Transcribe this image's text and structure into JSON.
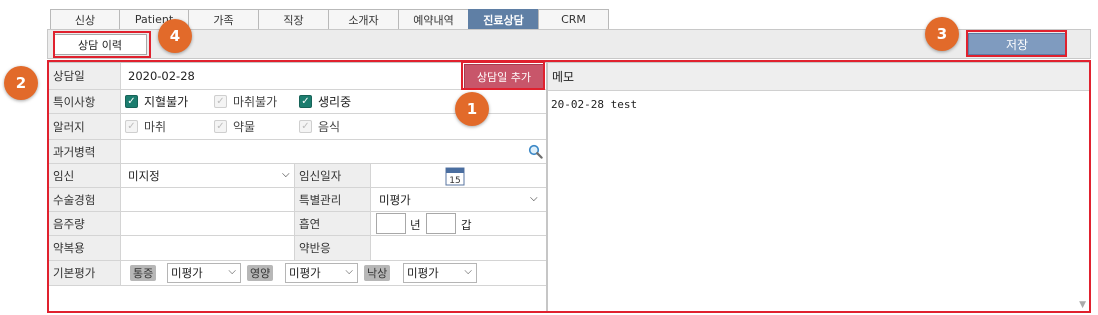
{
  "tabs": [
    "신상",
    "Patient",
    "가족",
    "직장",
    "소개자",
    "예약내역",
    "진료상담",
    "CRM"
  ],
  "active_tab": "진료상담",
  "toolbar": {
    "history_label": "상담 이력",
    "save_label": "저장"
  },
  "badges": [
    "1",
    "2",
    "3",
    "4"
  ],
  "form": {
    "date": {
      "label": "상담일",
      "value": "2020-02-28",
      "add_label": "상담일 추가"
    },
    "notes": {
      "label": "특이사항",
      "items": [
        {
          "label": "지혈불가",
          "checked": true
        },
        {
          "label": "마취불가",
          "checked": false
        },
        {
          "label": "생리중",
          "checked": true
        }
      ]
    },
    "allergy": {
      "label": "알러지",
      "items": [
        {
          "label": "마취",
          "checked": false
        },
        {
          "label": "약물",
          "checked": false
        },
        {
          "label": "음식",
          "checked": false
        }
      ]
    },
    "history": {
      "label": "과거병력",
      "value": ""
    },
    "pregnancy": {
      "label": "임신",
      "value": "미지정"
    },
    "pregnancy_date": {
      "label": "임신일자",
      "value": "",
      "calendar_text": "15"
    },
    "surgery": {
      "label": "수술경험",
      "value": ""
    },
    "special": {
      "label": "특별관리",
      "value": "미평가"
    },
    "drinking": {
      "label": "음주량",
      "value": ""
    },
    "smoking": {
      "label": "흡연",
      "unit_year": "년",
      "unit_pack": "갑"
    },
    "medication": {
      "label": "약복용",
      "value": ""
    },
    "reaction": {
      "label": "약반응",
      "value": ""
    },
    "basic": {
      "label": "기본평가",
      "items": [
        {
          "tag": "통증",
          "value": "미평가"
        },
        {
          "tag": "영양",
          "value": "미평가"
        },
        {
          "tag": "낙상",
          "value": "미평가"
        }
      ]
    }
  },
  "memo": {
    "header": "메모",
    "text": "20-02-28 test"
  }
}
